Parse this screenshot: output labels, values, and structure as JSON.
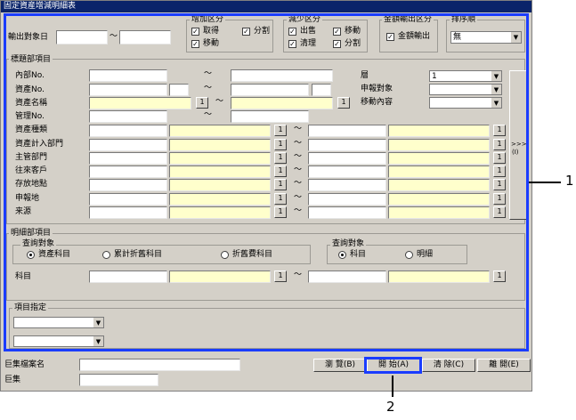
{
  "window": {
    "title": "固定資産增減明細表"
  },
  "top": {
    "output_label": "輸出對象日",
    "tilde": "～",
    "increase": {
      "title": "增加区分",
      "acquire": "取得",
      "split": "分割",
      "move": "移動"
    },
    "decrease": {
      "title": "減少区分",
      "sell": "出售",
      "move": "移動",
      "clear": "清理",
      "split": "分割"
    },
    "amount": {
      "title": "金額輸出区分",
      "amount_output": "金額輸出"
    },
    "sort": {
      "title": "排序順",
      "value": "無"
    }
  },
  "header_section": {
    "title": "標題部項目",
    "rows": [
      "內部No.",
      "資產No.",
      "資產名稱",
      "管理No.",
      "資產種類",
      "資產計入部門",
      "主管部門",
      "往來客戶",
      "存放地點",
      "申報地",
      "来源"
    ],
    "tilde": "～",
    "btn": "1",
    "right": {
      "layer_label": "層",
      "layer_value": "1",
      "report_label": "申報對象",
      "move_label": "移動內容"
    },
    "more": ">>>",
    "more_key": "(I)"
  },
  "detail_section": {
    "title": "明細部項目",
    "query1": {
      "title": "查詢對象",
      "asset": "資產科目",
      "accum": "累計折舊科目",
      "dep": "折舊費科目"
    },
    "query2": {
      "title": "查詢對象",
      "subject": "科目",
      "detail": "明細"
    },
    "subject_label": "科目",
    "btn": "1",
    "tilde": "～"
  },
  "item_spec": {
    "title": "項目指定"
  },
  "bottom": {
    "file_label": "巨集檔案名",
    "macro_label": "巨集",
    "browse": "瀏 覽(B)",
    "start": "開 始(A)",
    "clear": "清 除(C)",
    "close": "離 開(E)"
  },
  "callouts": {
    "one": "1",
    "two": "2"
  },
  "colors": {
    "highlight": "#1a3cff",
    "required_field": "#ffffcc"
  }
}
